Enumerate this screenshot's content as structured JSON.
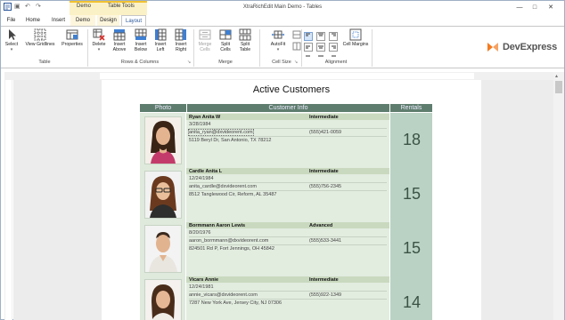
{
  "window": {
    "title": "XtraRichEdit Main Demo - Tables",
    "context_demo": "Demo",
    "context_table_tools": "Table Tools",
    "minimize": "—",
    "restore": "□",
    "close": "✕"
  },
  "qat": {
    "save": "▣",
    "undo": "↶",
    "redo": "↷"
  },
  "tabs": [
    {
      "label": "File"
    },
    {
      "label": "Home"
    },
    {
      "label": "Insert"
    },
    {
      "label": "Demo"
    },
    {
      "label": "Design"
    },
    {
      "label": "Layout"
    }
  ],
  "ribbon": {
    "table_group": {
      "label": "Table",
      "select": "Select",
      "gridlines": "View Gridlines",
      "properties": "Properties"
    },
    "rows_cols_group": {
      "label": "Rows & Columns",
      "delete": "Delete",
      "insert_above": "Insert Above",
      "insert_below": "Insert Below",
      "insert_left": "Insert Left",
      "insert_right": "Insert Right"
    },
    "merge_group": {
      "label": "Merge",
      "merge_cells": "Merge Cells",
      "split_cells": "Split Cells",
      "split_table": "Split Table"
    },
    "cell_size_group": {
      "label": "Cell Size",
      "autofit": "AutoFit"
    },
    "alignment_group": {
      "label": "Alignment",
      "cell_margins": "Cell Margins"
    },
    "logo": "DevExpress"
  },
  "document": {
    "title": "Active Customers",
    "headers": {
      "photo": "Photo",
      "info": "Customer Info",
      "rentals": "Rentals"
    },
    "customers": [
      {
        "name": "Ryan Anita W",
        "level": "Intermediate",
        "birth": "3/28/1984",
        "email": "anita_ryan@dxvideorent.com",
        "phone": "(555)421-0059",
        "address": "5119 Beryl Dr, San Antonio, TX 78212",
        "rentals": "18"
      },
      {
        "name": "Cardle Anita L",
        "level": "Intermediate",
        "birth": "12/24/1984",
        "email": "anita_cardle@dxvideorent.com",
        "phone": "(555)756-2345",
        "address": "8512 Tanglewood Cir,  Reform, AL 35487",
        "rentals": "15"
      },
      {
        "name": "Bormmann Aaron Lewis",
        "level": "Advanced",
        "birth": "8/20/1976",
        "email": "aaron_bormmann@dxvideorent.com",
        "phone": "(555)533-3441",
        "address": "824501 Rd P, Fort Jennings, OH 45842",
        "rentals": "15"
      },
      {
        "name": "Vicars Annie",
        "level": "Intermediate",
        "birth": "12/24/1981",
        "email": "annie_vicars@dxvideorent.com",
        "phone": "(555)922-1349",
        "address": "7287 New York Ave, Jersey City, NJ 07306",
        "rentals": "14"
      }
    ]
  },
  "colors": {
    "header_bg": "#5f7d6e",
    "info_bg": "#e2ecdf",
    "rentals_bg": "#b9d2c4",
    "accent": "#2b579a",
    "context_tab": "#f1c232"
  }
}
